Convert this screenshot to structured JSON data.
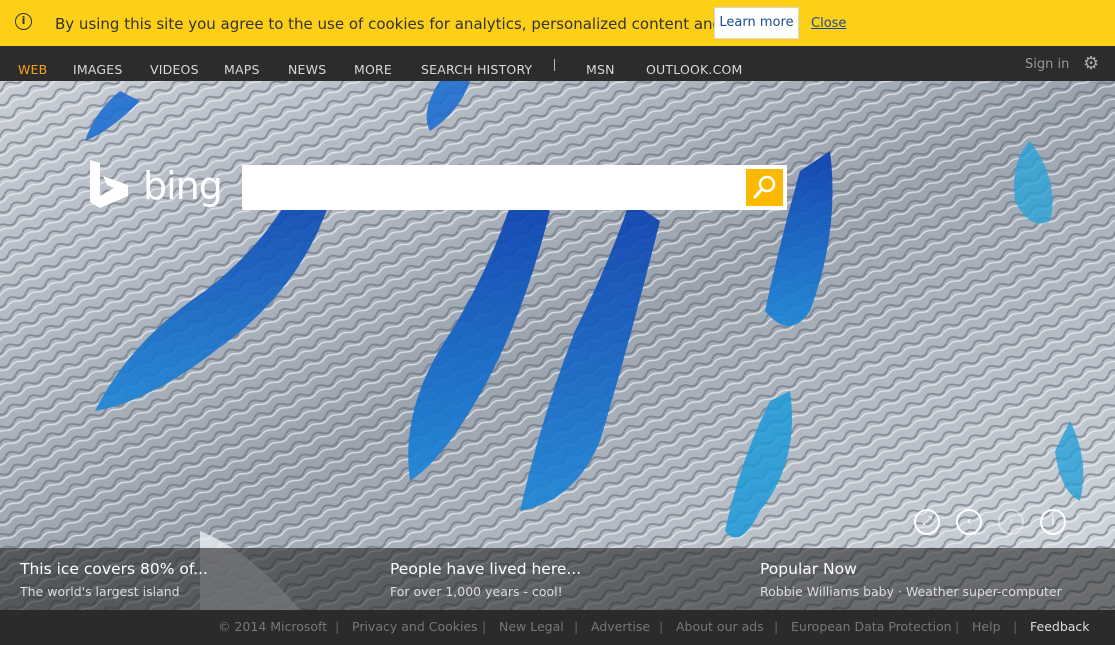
{
  "cookie_banner": {
    "message": "By using this site you agree to the use of cookies for analytics, personalized content and ads.",
    "learn_more": "Learn more",
    "close": "Close",
    "info_icon": "i"
  },
  "nav": {
    "items": [
      "WEB",
      "IMAGES",
      "VIDEOS",
      "MAPS",
      "NEWS",
      "MORE",
      "SEARCH HISTORY",
      "MSN",
      "OUTLOOK.COM"
    ],
    "sign_in": "Sign in",
    "settings_icon": "gear-icon"
  },
  "logo": {
    "text": "bing"
  },
  "search": {
    "value": "",
    "placeholder": ""
  },
  "captions": [
    {
      "title": "This ice covers 80% of...",
      "subtitle": "The world's largest island"
    },
    {
      "title": "People have lived here...",
      "subtitle": "For over 1,000 years - cool!"
    },
    {
      "title": "Popular Now",
      "subtitle": "Robbie Williams baby · Weather super-computer"
    }
  ],
  "hero_controls": [
    "fullscreen-icon",
    "previous-icon",
    "next-icon",
    "info-icon"
  ],
  "footer": {
    "copyright": "© 2014 Microsoft",
    "links": [
      "Privacy and Cookies",
      "New Legal",
      "Advertise",
      "About our ads",
      "European Data Protection",
      "Help"
    ],
    "feedback": "Feedback"
  },
  "colors": {
    "banner": "#fdd017",
    "accent": "#f7a21b",
    "search_button": "#fcb900",
    "nav_bg": "#2c2c2c"
  }
}
